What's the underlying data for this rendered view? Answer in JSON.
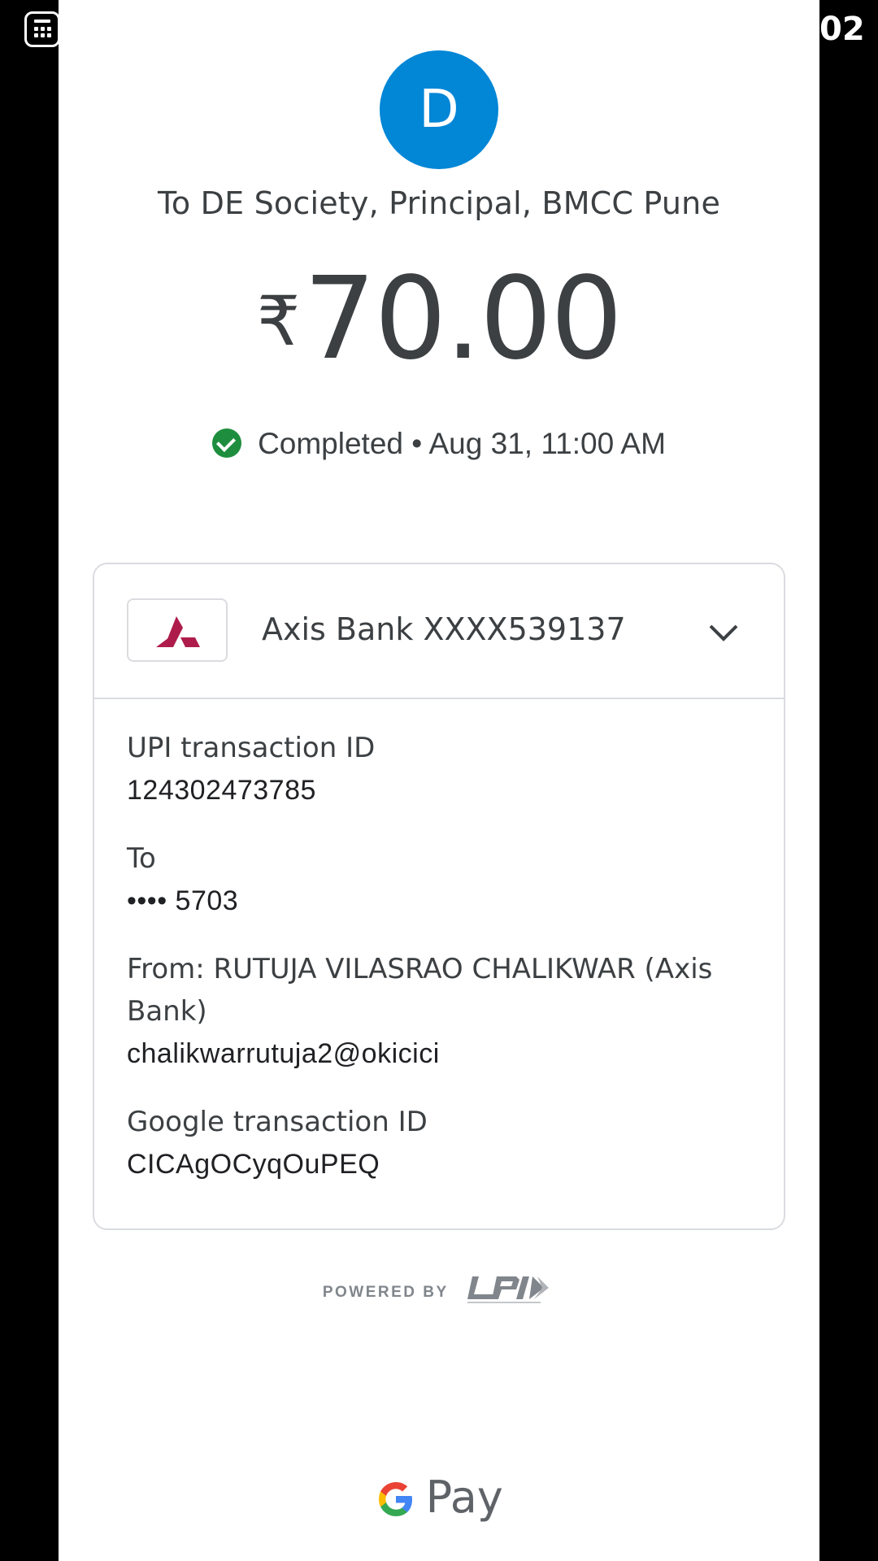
{
  "status_bar": {
    "clock": "02"
  },
  "payment": {
    "avatar_letter": "D",
    "payee": "To DE Society, Principal, BMCC Pune",
    "currency_symbol": "₹",
    "amount": "70.00",
    "status": "Completed",
    "separator": "•",
    "datetime": "Aug 31, 11:00 AM",
    "avatar_color": "#0286d6",
    "status_color": "#1e8e3e"
  },
  "bank": {
    "name": "Axis Bank XXXX539137",
    "logo_color": "#ae1c4b"
  },
  "details": [
    {
      "label": "UPI transaction ID",
      "values": [
        "124302473785"
      ]
    },
    {
      "label": "To",
      "values": [
        "•••• 5703"
      ]
    },
    {
      "label": "From: RUTUJA VILASRAO CHALIKWAR (Axis Bank)",
      "values": [
        "chalikwarrutuja2@okicici"
      ]
    },
    {
      "label": "Google transaction ID",
      "values": [
        "CICAgOCyqOuPEQ"
      ]
    }
  ],
  "footer": {
    "powered_by": "POWERED BY",
    "brand": "Pay"
  }
}
